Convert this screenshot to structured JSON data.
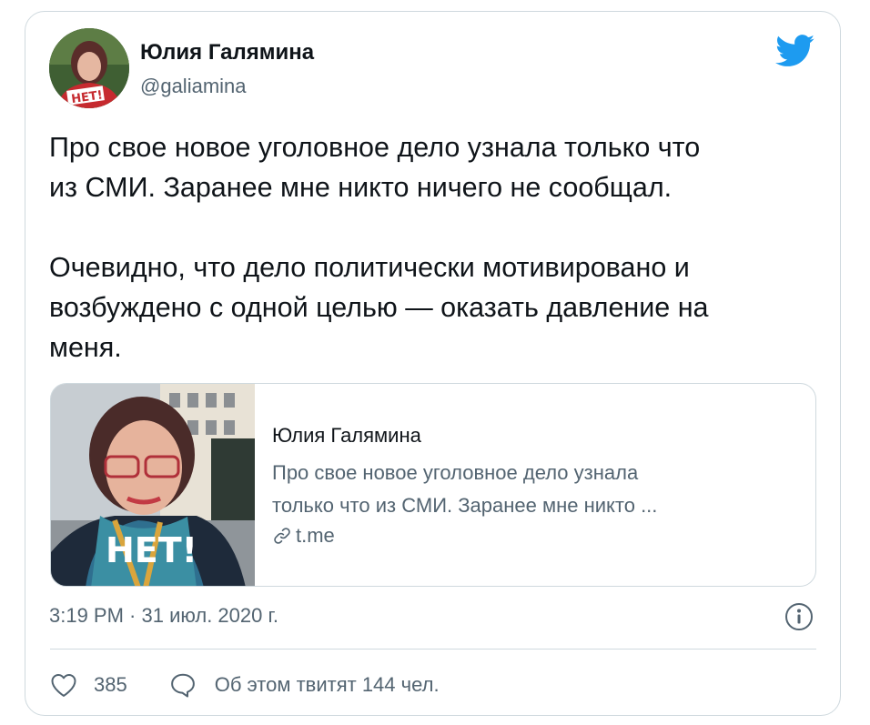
{
  "tweet": {
    "author": {
      "name": "Юлия Галямина",
      "handle": "@galiamina"
    },
    "paragraphs": [
      "Про свое новое уголовное дело узнала только что\nиз СМИ. Заранее мне никто ничего не сообщал.",
      "Очевидно, что дело политически мотивировано и\nвозбуждено с одной целью — оказать давление на\nменя."
    ],
    "link_card": {
      "title": "Юлия Галямина",
      "description": "Про свое новое уголовное дело узнала\nтолько что из СМИ. Заранее мне никто ...",
      "domain": "t.me",
      "thumbnail_text": "НЕТ!"
    },
    "timestamp": "3:19 PM · 31 июл. 2020 г.",
    "likes": "385",
    "replies_label": "Об этом твитят 144 чел.",
    "avatar_badge_text": "НЕТ!",
    "icons": {
      "brand": "twitter-bird-icon",
      "info": "info-icon",
      "like": "heart-icon",
      "reply": "speech-bubble-icon",
      "link": "link-icon"
    },
    "colors": {
      "brand_blue": "#1d9bf0",
      "text_primary": "#0f1419",
      "text_secondary": "#536471",
      "border": "#cfd9de"
    }
  }
}
